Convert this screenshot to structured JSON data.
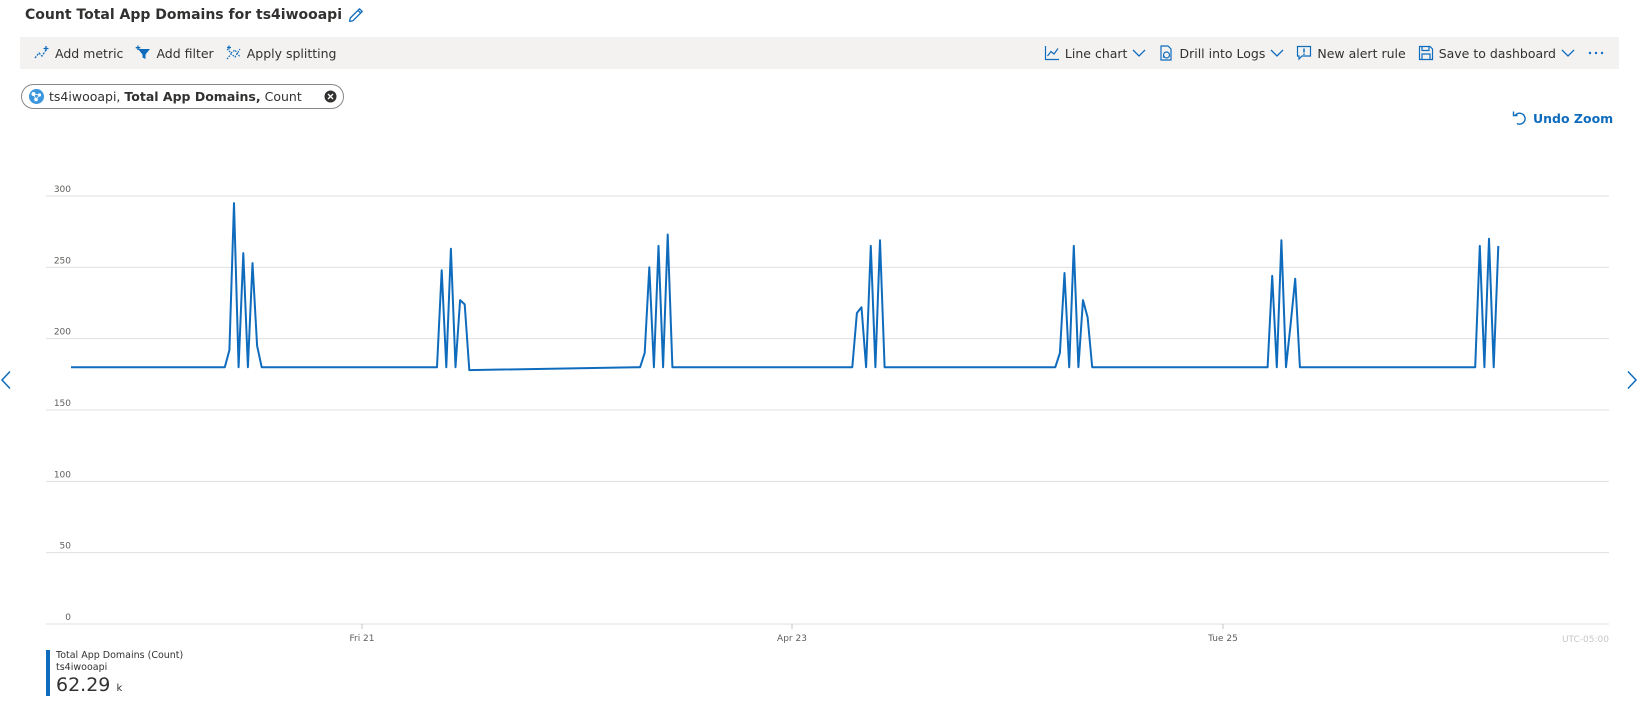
{
  "header": {
    "title": "Count Total App Domains for ts4iwooapi"
  },
  "toolbar": {
    "left": [
      {
        "label": "Add metric",
        "icon": "add-metric-icon"
      },
      {
        "label": "Add filter",
        "icon": "filter-icon"
      },
      {
        "label": "Apply splitting",
        "icon": "splitting-icon"
      }
    ],
    "right": {
      "line_chart": "Line chart",
      "drill_logs": "Drill into Logs",
      "new_alert": "New alert rule",
      "save_dashboard": "Save to dashboard"
    }
  },
  "metric_pill": {
    "resource": "ts4iwooapi,",
    "metric": "Total App Domains,",
    "aggregation": "Count"
  },
  "undo_zoom": "Undo Zoom",
  "legend": {
    "name": "Total App Domains (Count)",
    "resource": "ts4iwooapi",
    "value": "62.29",
    "unit": "k"
  },
  "colors": {
    "series": "#0f6cbd",
    "accent": "#0f6cbd",
    "grid": "#e1dfdd",
    "toolbar_bg": "#f3f2f1"
  },
  "chart_data": {
    "type": "line",
    "ylim": [
      0,
      300
    ],
    "y_ticks": [
      0,
      50,
      100,
      150,
      200,
      250,
      300
    ],
    "x_ticks": [
      "Fri 21",
      "Apr 23",
      "Tue 25"
    ],
    "timezone_label": "UTC-05:00",
    "grid": true,
    "series": [
      {
        "values": [
          180,
          180,
          180,
          180,
          180,
          180,
          180,
          180,
          180,
          180,
          180,
          180,
          180,
          180,
          180,
          180,
          180,
          180,
          180,
          192,
          295,
          180,
          260,
          180,
          253,
          195,
          180,
          180,
          180,
          180,
          180,
          180,
          180,
          180,
          180,
          180,
          180,
          180,
          180,
          180,
          180,
          180,
          180,
          180,
          180,
          180,
          180,
          180,
          180,
          180,
          180,
          180,
          180,
          180,
          180,
          180,
          180,
          180,
          180,
          180,
          180,
          180,
          180,
          180,
          180,
          180,
          180,
          180,
          180,
          180,
          180,
          180,
          180,
          180,
          180,
          180,
          180,
          180,
          180,
          180,
          180,
          180,
          180,
          180,
          180,
          180,
          180,
          180,
          180,
          180,
          180,
          180,
          180,
          180,
          180,
          180,
          180,
          180,
          180,
          180,
          180,
          180,
          180,
          180,
          180,
          180,
          180,
          180,
          180,
          180,
          180,
          180,
          180,
          180,
          180,
          180,
          180,
          180,
          180,
          180,
          180,
          180,
          180,
          180,
          180,
          180,
          180,
          180,
          180,
          180,
          180,
          180,
          180,
          180,
          180,
          180,
          180,
          180,
          180,
          180,
          180,
          180,
          180,
          180,
          180,
          180,
          180,
          180,
          180,
          180,
          180,
          180,
          180,
          180,
          180,
          180,
          180,
          180,
          180,
          180,
          180,
          180,
          180,
          180,
          180,
          180,
          180,
          180,
          180,
          180,
          180,
          180,
          180,
          180,
          180,
          180,
          180,
          180,
          180,
          180,
          180,
          180,
          180,
          180,
          180,
          180,
          180,
          180,
          180,
          180,
          180,
          180,
          180,
          180,
          180,
          180,
          180,
          180,
          180,
          180,
          180,
          180,
          180,
          180,
          180,
          180,
          180,
          180,
          180,
          180,
          180,
          180,
          180,
          180,
          180,
          180,
          180,
          180,
          180,
          180,
          180,
          180,
          180,
          180,
          180,
          180,
          180,
          180,
          180,
          180,
          180,
          180,
          180,
          180,
          180,
          180,
          180,
          180,
          180,
          180,
          180,
          180,
          180,
          180,
          180,
          180,
          180,
          180,
          180,
          180,
          180,
          180,
          180,
          180,
          180,
          180,
          180,
          180,
          180,
          180,
          180,
          180,
          180,
          180,
          180,
          180,
          180,
          180,
          180,
          180,
          180,
          180,
          180,
          180,
          180,
          180,
          180,
          180,
          180,
          180,
          180,
          180,
          180,
          180,
          180,
          180,
          180,
          180,
          180,
          180,
          180,
          180,
          180,
          180,
          180,
          180,
          180,
          180,
          180,
          180,
          180,
          180,
          180,
          180,
          180,
          180,
          180,
          180,
          180,
          180,
          180,
          180,
          180,
          180,
          180,
          180,
          180,
          180,
          180,
          180,
          180,
          180,
          180,
          180,
          180,
          180,
          180,
          180,
          180,
          180,
          180,
          180,
          180,
          180,
          180,
          180,
          180,
          180,
          180,
          180,
          180,
          180,
          180,
          180,
          180,
          180,
          180,
          180,
          180,
          180,
          180,
          180,
          180,
          180,
          180,
          180,
          180,
          180,
          180,
          180,
          180,
          180,
          180,
          180,
          180,
          180,
          180,
          180,
          180,
          180,
          180,
          180,
          180,
          180,
          180,
          180,
          180,
          180,
          180,
          180,
          180,
          180,
          180,
          180,
          180,
          180,
          180,
          180,
          180,
          180,
          180,
          180,
          180,
          180,
          180,
          180,
          180,
          180,
          180,
          180,
          180,
          180,
          180,
          180,
          180,
          180,
          180,
          180,
          180,
          180,
          180,
          180,
          180,
          180,
          180,
          180,
          180,
          180,
          180,
          180,
          180,
          180,
          180,
          180,
          180,
          180,
          180,
          180,
          180,
          180,
          180,
          180,
          180,
          180,
          180,
          180,
          180,
          180,
          180,
          180,
          180,
          180,
          180,
          180,
          180,
          180,
          180,
          180,
          180,
          180,
          180,
          180,
          180,
          180,
          180,
          180,
          180,
          180,
          180,
          180,
          180,
          180,
          180,
          180,
          180,
          180,
          180,
          180,
          180,
          180,
          180,
          180,
          180,
          180,
          180,
          180,
          180,
          180,
          180,
          180,
          180,
          180,
          180,
          180,
          180,
          180,
          180,
          180,
          180,
          180,
          180,
          180,
          180,
          180,
          180,
          180,
          180,
          180,
          180,
          180,
          180,
          180,
          180,
          180,
          180,
          180,
          180,
          180,
          180,
          180,
          180,
          180,
          180,
          180,
          180,
          180,
          180,
          180,
          180,
          180,
          180,
          180,
          180,
          180,
          180,
          180,
          180,
          180,
          180,
          180,
          180,
          180,
          180,
          180,
          180,
          180,
          180,
          180,
          180,
          180,
          180,
          180,
          180,
          180,
          180,
          180,
          180,
          180,
          180,
          180,
          180,
          180,
          180,
          180,
          180,
          180,
          180,
          180,
          180,
          180,
          180,
          180,
          180,
          180,
          180,
          180,
          180,
          180,
          180,
          180,
          180,
          180,
          180,
          180,
          180,
          180,
          180,
          180,
          180,
          180,
          180,
          180,
          180,
          180,
          180,
          180,
          180,
          180,
          180,
          180,
          180,
          180,
          180,
          180,
          180,
          180,
          180,
          180,
          180,
          180,
          180,
          180,
          180,
          180,
          180,
          180,
          180,
          180,
          180,
          180,
          180,
          180,
          180,
          180,
          180,
          180,
          180,
          180,
          180,
          180,
          180,
          180,
          180,
          180,
          180,
          180,
          180,
          180,
          180,
          180,
          180,
          180,
          180,
          180,
          180,
          180,
          180,
          180,
          180,
          180,
          180,
          180,
          180,
          180,
          180,
          180,
          180,
          180,
          180,
          180,
          180,
          180,
          180,
          180,
          180,
          180,
          180,
          180,
          180,
          180,
          180,
          180,
          180,
          180,
          180,
          180,
          180,
          180,
          180,
          180,
          180,
          180,
          180,
          180,
          180,
          180,
          180,
          180,
          180,
          180,
          180,
          180,
          180,
          180,
          180,
          180,
          180,
          180,
          180,
          180,
          180,
          180,
          180,
          180,
          180,
          180,
          180,
          180,
          180,
          180,
          180,
          180,
          180,
          180,
          180,
          180,
          180,
          180,
          180,
          180,
          180,
          180,
          180,
          180,
          180,
          180,
          180,
          180,
          180,
          180,
          180,
          180,
          180,
          180,
          180,
          180,
          180,
          180,
          180,
          180,
          180,
          180,
          180,
          180,
          180,
          180,
          180,
          180,
          180,
          180,
          180,
          180,
          180,
          180,
          180,
          180,
          180,
          180,
          180,
          180,
          180,
          180,
          180,
          180,
          180,
          180,
          180,
          180,
          180,
          180,
          180,
          180,
          180,
          180,
          180,
          180,
          180,
          180,
          180,
          180,
          180,
          180,
          180,
          180,
          180,
          180,
          180,
          180,
          180,
          180,
          180,
          180,
          180,
          180,
          180,
          180,
          180,
          180,
          180,
          180,
          180,
          180,
          180,
          180,
          180,
          180,
          180,
          180,
          180,
          180,
          180,
          180,
          180,
          180,
          180,
          180,
          180,
          180,
          180,
          180,
          180,
          180,
          180,
          180,
          180,
          180,
          180,
          180,
          180,
          180,
          180,
          180,
          180,
          180,
          180,
          180,
          180,
          180,
          180,
          180,
          180,
          180,
          180,
          180,
          180,
          180,
          180,
          180,
          180,
          180,
          180,
          180,
          180,
          180,
          180,
          180,
          180,
          180,
          180,
          180,
          180,
          180,
          180,
          180,
          180,
          180,
          180,
          180,
          180,
          180,
          180,
          180,
          180,
          180,
          180,
          180,
          180,
          180,
          180,
          180,
          180,
          180,
          180,
          180,
          180,
          180,
          180,
          180,
          180,
          180,
          180,
          180,
          180,
          180,
          180,
          180,
          180,
          180,
          180,
          180,
          180,
          180,
          180,
          180,
          180,
          180,
          180,
          180,
          180,
          180
        ]
      }
    ]
  }
}
